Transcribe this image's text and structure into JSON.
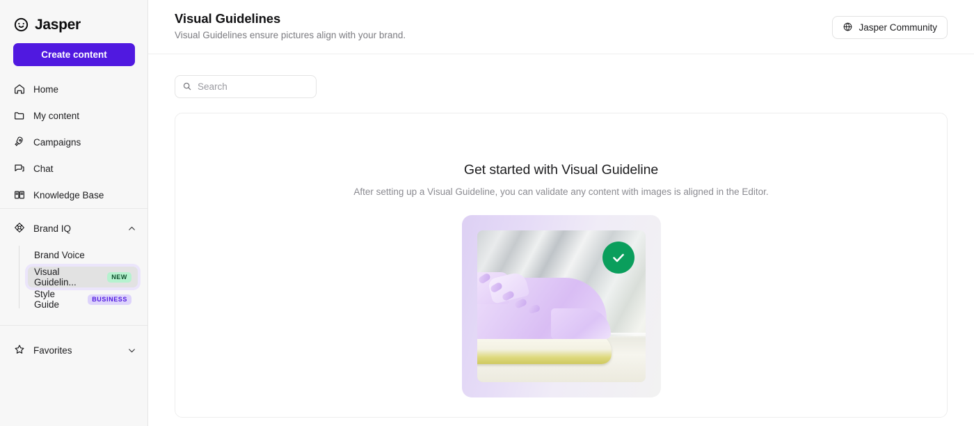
{
  "sidebar": {
    "brand": {
      "name": "Jasper",
      "logo_icon": "jasper-smiley-logo"
    },
    "create_button": {
      "label": "Create content"
    },
    "nav_items": [
      {
        "label": "Home",
        "icon": "home-icon"
      },
      {
        "label": "My content",
        "icon": "folder-icon"
      },
      {
        "label": "Campaigns",
        "icon": "rocket-icon"
      },
      {
        "label": "Chat",
        "icon": "chat-bubble-icon"
      },
      {
        "label": "Knowledge Base",
        "icon": "book-icon"
      }
    ],
    "brand_iq": {
      "label": "Brand IQ",
      "icon": "brand-iq-icon",
      "chevron": "chevron-up-icon",
      "expanded": true,
      "items": [
        {
          "label": "Brand Voice",
          "badge": "",
          "selected": false
        },
        {
          "label": "Visual Guidelin...",
          "badge": "NEW",
          "selected": true
        },
        {
          "label": "Style Guide",
          "badge": "BUSINESS",
          "selected": false
        }
      ]
    },
    "favorites": {
      "label": "Favorites",
      "icon": "star-icon",
      "chevron": "chevron-down-icon"
    }
  },
  "header": {
    "title": "Visual Guidelines",
    "subtitle": "Visual Guidelines ensure pictures align with your brand.",
    "community_button": {
      "label": "Jasper Community",
      "icon": "globe-icon"
    }
  },
  "toolbar": {
    "search": {
      "value": "",
      "placeholder": "Search",
      "icon": "search-icon"
    }
  },
  "empty_state": {
    "title": "Get started with Visual Guideline",
    "description": "After setting up a Visual Guideline, you can validate any content with images is aligned in the Editor.",
    "illustration": {
      "image_alt": "lavender-sneaker-photo",
      "status_badge_icon": "green-check-icon"
    }
  },
  "colors": {
    "accent_purple": "#5019e0",
    "sidebar_bg": "#f7f7f7",
    "selected_item_bg": "#e2e2e2",
    "selected_item_ring": "#ebe5fb",
    "badge_new_bg": "#b6f2cf",
    "badge_new_text": "#0b4d2a",
    "badge_business_bg": "#ddd3fb",
    "badge_business_text": "#5019e0",
    "check_green": "#0a9e5c",
    "text_primary": "#1c1c1e",
    "text_muted": "#8a8a90"
  }
}
